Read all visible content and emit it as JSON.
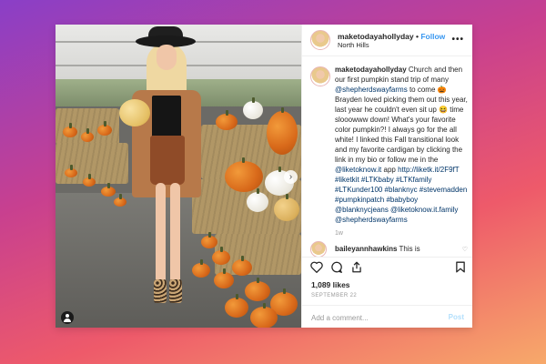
{
  "post": {
    "username": "maketodayahollyday",
    "follow_label": "Follow",
    "location": "North Hills",
    "more_label": "•••"
  },
  "caption": {
    "username": "maketodayahollyday",
    "text_1": " Church and then our first pumpkin stand trip of many ",
    "mention_1": "@shepherdswayfarms",
    "text_2": " to come 🎃 Brayden loved picking them out this year, last year he couldn't even sit up 😆 time slooowww down! What's your favorite color pumpkin?! I always go for the all white! I linked this Fall transitional look and my favorite cardigan by clicking the link in my bio or follow me in the ",
    "mention_2": "@liketoknow.it",
    "text_3": " app ",
    "link": "http://liketk.it/2F9fT",
    "tags": "#liketkit #LTKbaby #LTKfamily #LTKunder100 #blanknyc #stevemadden #pumpkinpatch #babyboy @blanknycjeans @liketoknow.it.family @shepherdswayfarms",
    "time": "1w"
  },
  "comment": {
    "username": "baileyannhawkins",
    "text": " This is"
  },
  "actions": {
    "likes": "1,089 likes",
    "date": "SEPTEMBER 22"
  },
  "composer": {
    "placeholder": "Add a comment...",
    "post_label": "Post"
  },
  "icons": {
    "like": "heart-icon",
    "comment": "comment-icon",
    "share": "share-icon",
    "save": "bookmark-icon",
    "more": "more-icon",
    "next": "chevron-right-icon",
    "user_tag": "user-tag-icon"
  },
  "colors": {
    "link": "#3897f0",
    "hashtag": "#003569",
    "post_disabled": "#b2dffc"
  }
}
